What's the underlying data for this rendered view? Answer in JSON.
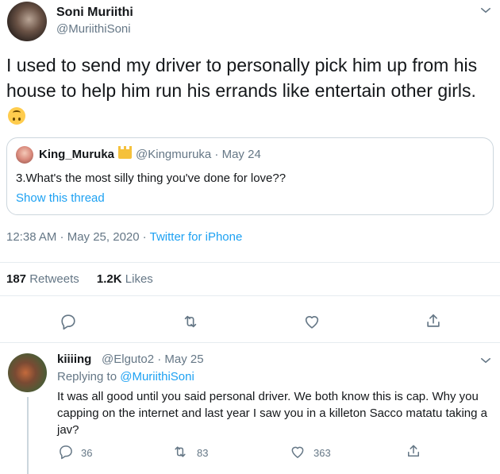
{
  "main_tweet": {
    "author_name": "Soni Muriithi",
    "author_handle": "@MuriithiSoni",
    "text": "I used to send my driver to personally pick him up from his house to help him run his errands like entertain other girls.",
    "emoji": "upside-down-face",
    "quoted": {
      "author_name": "King_Muruka",
      "author_handle": "@Kingmuruka · May 24",
      "text": "3.What's the most silly thing you've done for love??",
      "link_text": "Show this thread"
    },
    "time": "12:38 AM · May 25, 2020",
    "separator": "·",
    "source": "Twitter for iPhone",
    "retweets_count": "187",
    "retweets_label": "Retweets",
    "likes_count": "1.2K",
    "likes_label": "Likes"
  },
  "reply": {
    "author_name": "kiiiing",
    "author_handle": "@Elguto2 · May 25",
    "replying_prefix": "Replying to",
    "replying_mention": "@MuriithiSoni",
    "text": "It was all good until you said personal driver. We both know this is cap. Why you capping on the internet and last year I saw you in a killeton Sacco matatu taking a jav?",
    "reply_count": "36",
    "retweet_count": "83",
    "like_count": "363"
  },
  "colors": {
    "accent": "#1da1f2",
    "secondary_text": "#657786",
    "primary_text": "#14171a",
    "border": "#e6ecf0"
  }
}
